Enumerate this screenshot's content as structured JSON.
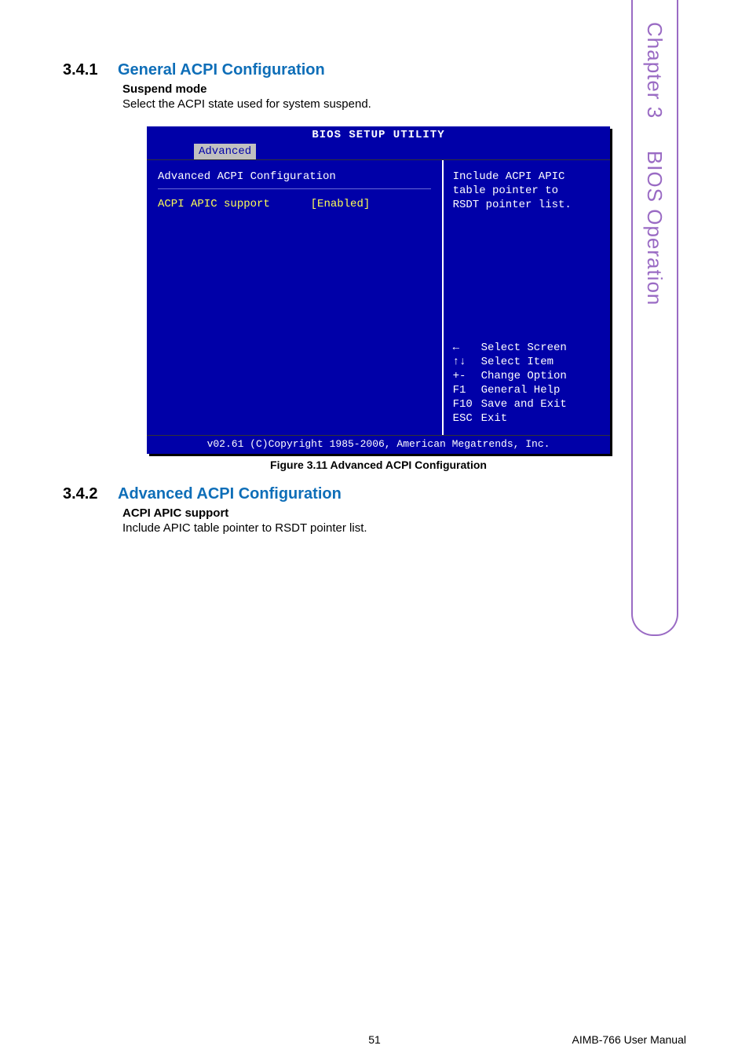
{
  "sideTab": {
    "chapter": "Chapter 3",
    "title": "BIOS Operation"
  },
  "section1": {
    "number": "3.4.1",
    "title": "General ACPI Configuration",
    "itemName": "Suspend mode",
    "itemDesc": "Select the ACPI state used for system suspend."
  },
  "bios": {
    "utilityTitle": "BIOS SETUP UTILITY",
    "menuTab": "Advanced",
    "panelTitle": "Advanced ACPI Configuration",
    "option": {
      "label": "ACPI APIC support",
      "value": "[Enabled]"
    },
    "help": {
      "line1": "Include ACPI APIC",
      "line2": "table pointer to",
      "line3": "RSDT pointer list."
    },
    "keys": [
      {
        "key": "←",
        "action": "Select Screen"
      },
      {
        "key": "↑↓",
        "action": "Select Item"
      },
      {
        "key": "+-",
        "action": "Change Option"
      },
      {
        "key": "F1",
        "action": "General Help"
      },
      {
        "key": "F10",
        "action": "Save and Exit"
      },
      {
        "key": "ESC",
        "action": "Exit"
      }
    ],
    "footer": "v02.61 (C)Copyright 1985-2006, American Megatrends, Inc."
  },
  "figureCaption": "Figure 3.11 Advanced ACPI Configuration",
  "section2": {
    "number": "3.4.2",
    "title": "Advanced ACPI Configuration",
    "itemName": "ACPI APIC support",
    "itemDesc": "Include APIC table pointer to RSDT pointer list."
  },
  "footer": {
    "pageNumber": "51",
    "docName": "AIMB-766 User Manual"
  }
}
